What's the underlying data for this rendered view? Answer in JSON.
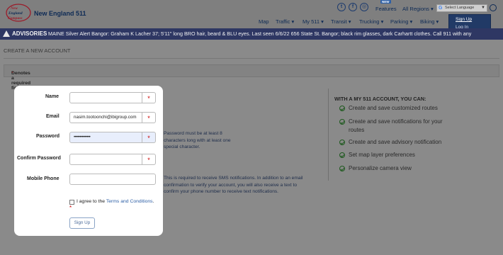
{
  "header": {
    "logo_line1": "New",
    "logo_line2": "England",
    "logo_line3": "Compass",
    "site_name": "New England 511",
    "social": [
      "t",
      "f",
      "◎"
    ],
    "features_label": "Features",
    "new_badge": "NEW",
    "regions_label": "All Regions ▾",
    "language_label": "Select Language",
    "nav": [
      "Map",
      "Traffic ▾",
      "My 511 ▾",
      "Transit ▾",
      "Trucking ▾",
      "Parking ▾",
      "Biking ▾"
    ]
  },
  "account_menu": {
    "items": [
      "Sign Up",
      "Log In"
    ]
  },
  "advisory": {
    "label": "ADVISORIES",
    "text": "MAINE Silver Alert Bangor: Graham K Lacher 37; 5'11\" long BRO hair, beard & BLU eyes. Last seen 6/6/22 656 State St. Bangor; black rim glasses, dark Carhartt clothes. Call 911 with any"
  },
  "page": {
    "title": "CREATE A NEW ACCOUNT",
    "required_star": "*",
    "required_note": "Denotes a required field"
  },
  "form": {
    "name_label": "Name",
    "name_value": "",
    "email_label": "Email",
    "email_value": "nasim.tootoonchi@ibigroup.com",
    "password_label": "Password",
    "password_value": "••••••••••••••",
    "confirm_label": "Confirm Password",
    "confirm_value": "",
    "phone_label": "Mobile Phone",
    "phone_value": "",
    "required_mark": "*",
    "agree_text": "I agree to the ",
    "terms_link": "Terms and Conditions",
    "agree_end": ".",
    "agree_star": "*",
    "submit_label": "Sign Up"
  },
  "hints": {
    "password_line1": "Password must be at least 8",
    "password_line2": "characters long with at least one",
    "password_line3": "special character.",
    "phone_line1": "This is required to receive SMS notifications. In addition to an email",
    "phone_line2": "confirmation to verify your account, you will also receive a text to",
    "phone_line3": "confirm your phone number to receive text notifications."
  },
  "benefits": {
    "title": "WITH A MY 511 ACCOUNT, YOU CAN:",
    "items": [
      [
        "Create and save customized routes"
      ],
      [
        "Create and save notifications for your",
        "routes"
      ],
      [
        "Create and save advisory notification"
      ],
      [
        "Set map layer preferences"
      ],
      [
        "Personalize camera view"
      ]
    ]
  }
}
